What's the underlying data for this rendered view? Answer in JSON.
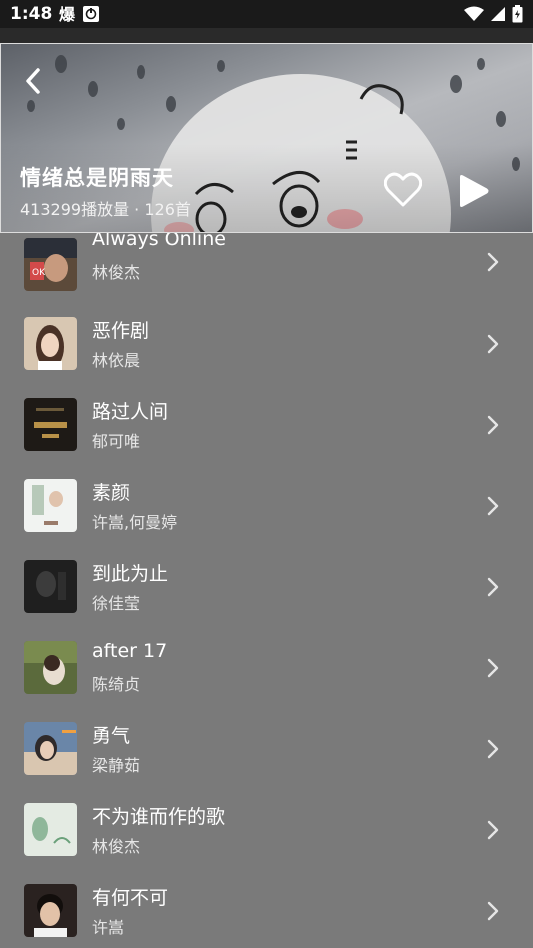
{
  "status_bar": {
    "time": "1:48",
    "notif_icon_1": "app-notification-icon",
    "notif_icon_2": "screenshot-icon"
  },
  "playlist": {
    "title": "情绪总是阴雨天",
    "subtitle": "413299播放量 · 126首"
  },
  "songs": [
    {
      "title": "Always Online",
      "artist": "林俊杰",
      "cover_color": "#5c4a3a"
    },
    {
      "title": "恶作剧",
      "artist": "林依晨",
      "cover_color": "#c9b39a"
    },
    {
      "title": "路过人间",
      "artist": "郁可唯",
      "cover_color": "#1e1a16"
    },
    {
      "title": "素颜",
      "artist": "许嵩,何曼婷",
      "cover_color": "#e8ece8"
    },
    {
      "title": "到此为止",
      "artist": "徐佳莹",
      "cover_color": "#1f1f1f"
    },
    {
      "title": "after 17",
      "artist": "陈绮贞",
      "cover_color": "#5b6a3c"
    },
    {
      "title": "勇气",
      "artist": "梁静茹",
      "cover_color": "#6a86a8"
    },
    {
      "title": "不为谁而作的歌",
      "artist": "林俊杰",
      "cover_color": "#dfe8df"
    },
    {
      "title": "有何不可",
      "artist": "许嵩",
      "cover_color": "#2a2220"
    }
  ]
}
